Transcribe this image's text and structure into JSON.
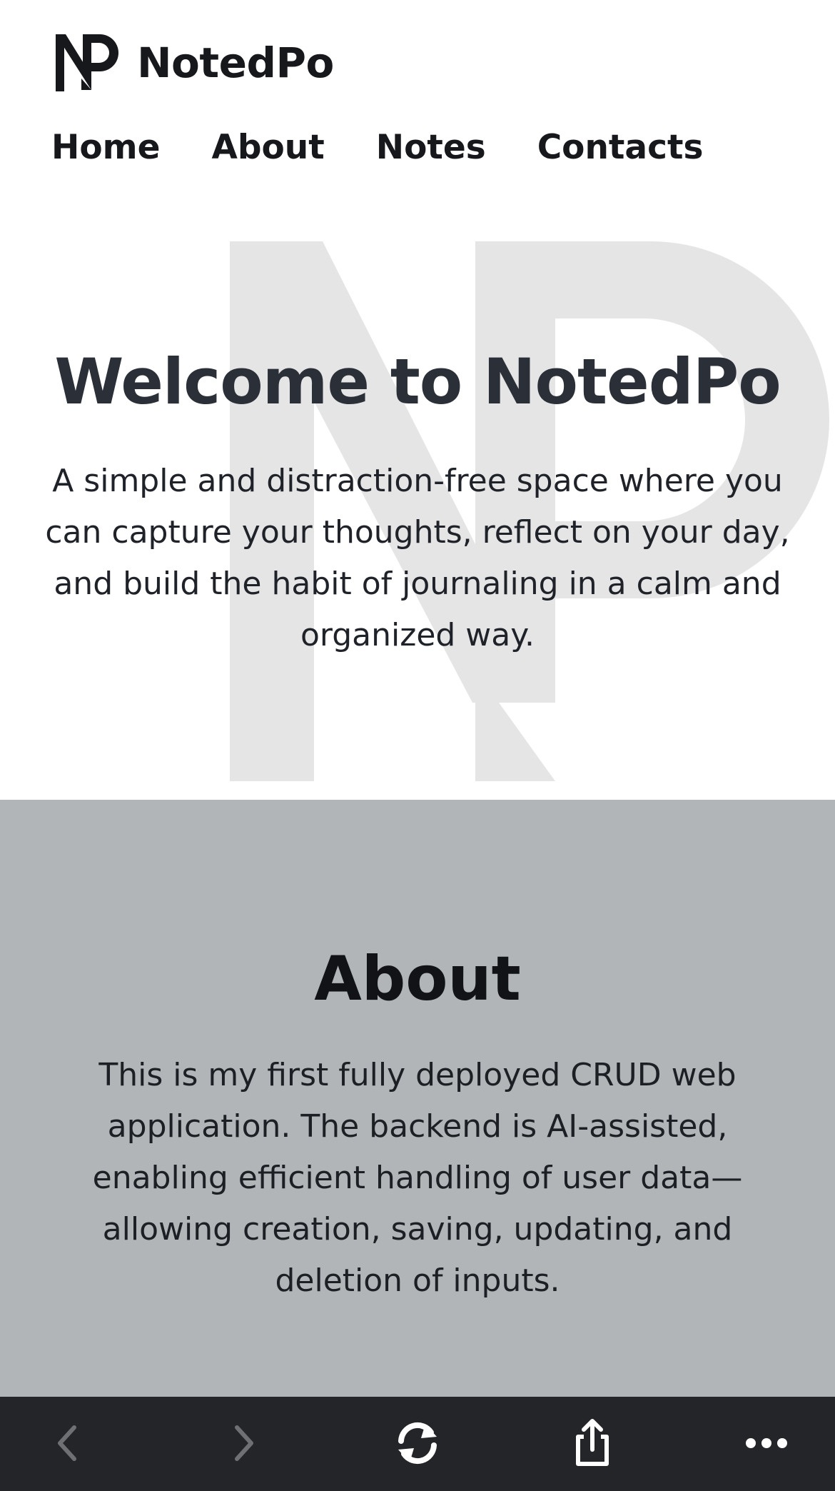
{
  "brand": {
    "name": "NotedPo",
    "logo_icon": "np-monogram-icon"
  },
  "nav": {
    "items": [
      {
        "label": "Home"
      },
      {
        "label": "About"
      },
      {
        "label": "Notes"
      },
      {
        "label": "Contacts"
      }
    ]
  },
  "hero": {
    "title": "Welcome to NotedPo",
    "text": "A simple and distraction-free space where you can capture your thoughts, reflect on your day, and build the habit of journaling in a calm and organized way.",
    "watermark_icon": "np-monogram-watermark"
  },
  "about": {
    "title": "About",
    "text": "This is my first fully deployed CRUD web application. The backend is AI-assisted, enabling efficient handling of user data—allowing creation, saving, updating, and deletion of inputs."
  },
  "toolbar": {
    "buttons": [
      {
        "icon": "back-arrow-icon"
      },
      {
        "icon": "forward-arrow-icon"
      },
      {
        "icon": "reload-icon"
      },
      {
        "icon": "share-icon"
      },
      {
        "icon": "more-options-icon"
      }
    ]
  },
  "colors": {
    "text_dark": "#16181c",
    "hero_title": "#2a2f38",
    "watermark": "#e5e5e6",
    "about_bg": "#b2b5b8",
    "toolbar_bg": "#242528",
    "toolbar_icon": "#ffffff",
    "toolbar_icon_disabled": "#6f7074"
  }
}
